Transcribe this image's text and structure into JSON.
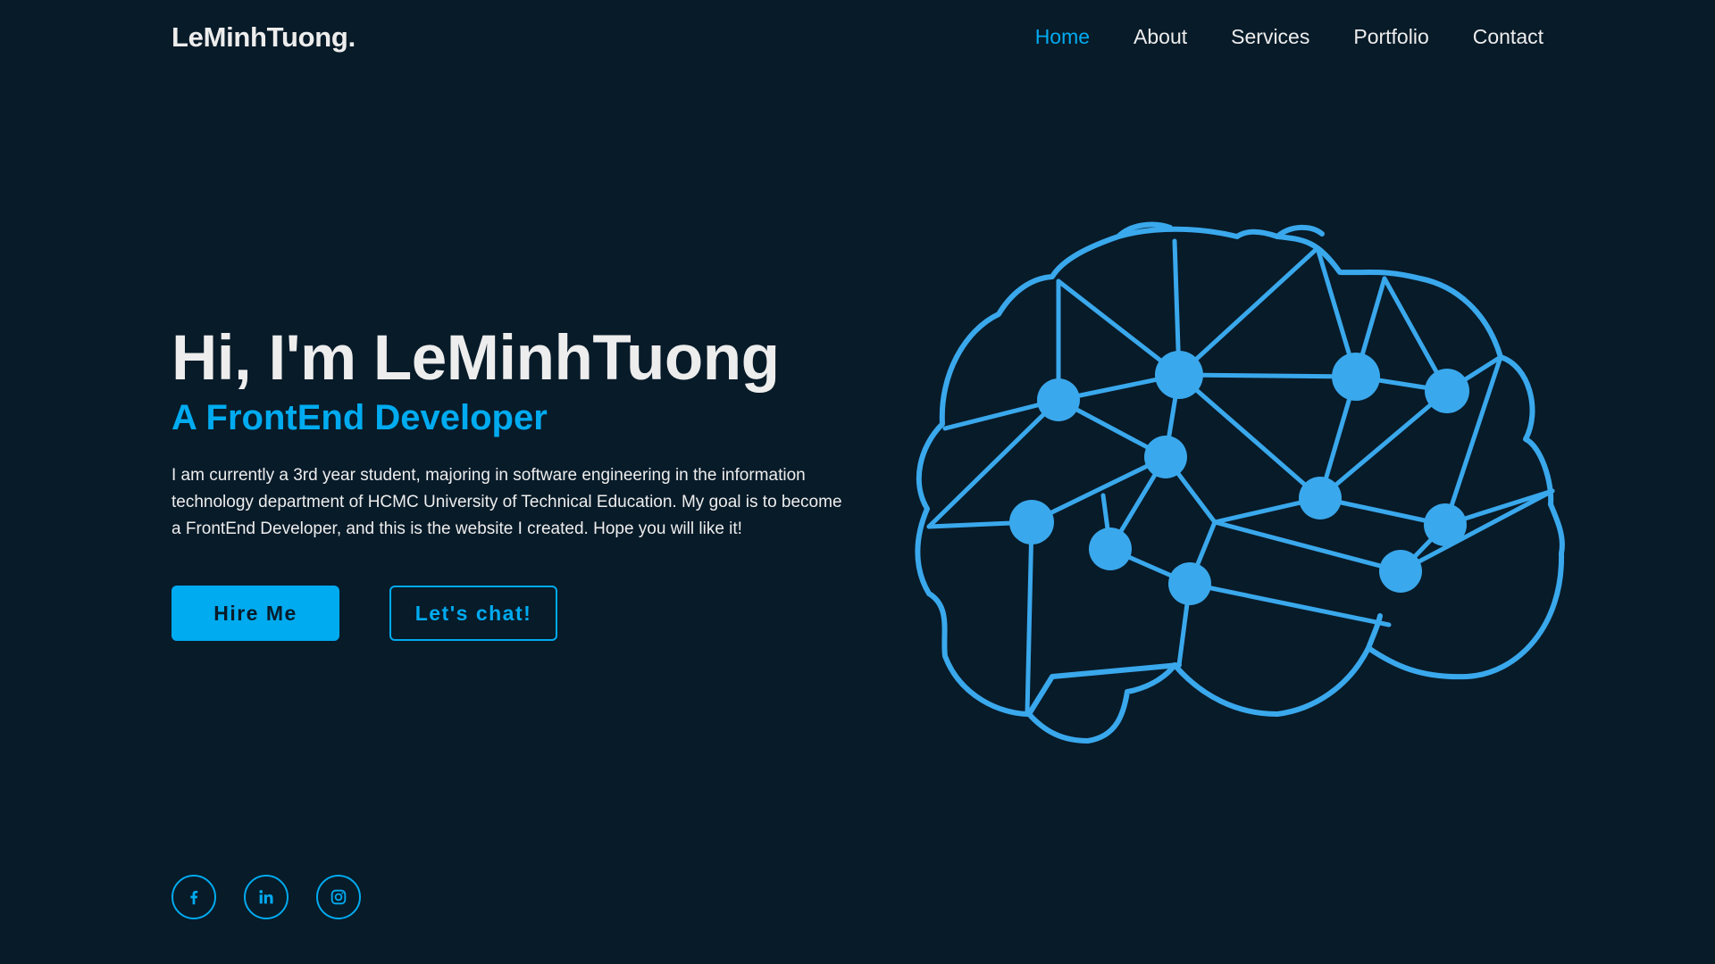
{
  "header": {
    "logo": "LeMinhTuong.",
    "nav": [
      {
        "label": "Home",
        "active": true
      },
      {
        "label": "About",
        "active": false
      },
      {
        "label": "Services",
        "active": false
      },
      {
        "label": "Portfolio",
        "active": false
      },
      {
        "label": "Contact",
        "active": false
      }
    ]
  },
  "hero": {
    "title": "Hi, I'm LeMinhTuong",
    "subtitle": "A FrontEnd Developer",
    "description": "I am currently a 3rd year student, majoring in software engineering in the information technology department of HCMC University of Technical Education. My goal is to become a FrontEnd Developer, and this is the website I created. Hope you will like it!",
    "buttons": {
      "hire": "Hire Me",
      "chat": "Let's chat!"
    }
  },
  "social": [
    {
      "name": "facebook-icon"
    },
    {
      "name": "linkedin-icon"
    },
    {
      "name": "instagram-icon"
    }
  ],
  "illustration": {
    "name": "brain-network-icon"
  },
  "colors": {
    "background": "#081b29",
    "accent": "#00abf0",
    "illustration": "#3aa8ec",
    "text": "#ededed"
  }
}
